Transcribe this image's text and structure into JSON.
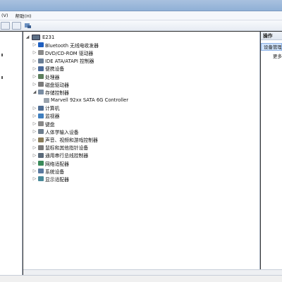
{
  "menubar": {
    "items": [
      {
        "label": "(V)"
      },
      {
        "label": "帮助(H)"
      }
    ]
  },
  "toolbar": {
    "buttons": [
      "back-icon",
      "properties-icon",
      "help-icon"
    ]
  },
  "tree": {
    "root": "E231",
    "nodes": [
      {
        "label": "Bluetooth 无线电收发器",
        "icon": "bluetooth-icon",
        "expanded": false
      },
      {
        "label": "DVD/CD-ROM 驱动器",
        "icon": "dvd-drive-icon",
        "expanded": false
      },
      {
        "label": "IDE ATA/ATAPI 控制器",
        "icon": "ide-controller-icon",
        "expanded": false
      },
      {
        "label": "便携设备",
        "icon": "portable-device-icon",
        "expanded": false
      },
      {
        "label": "处理器",
        "icon": "processor-icon",
        "expanded": false
      },
      {
        "label": "磁盘驱动器",
        "icon": "disk-drive-icon",
        "expanded": false
      },
      {
        "label": "存储控制器",
        "icon": "storage-controller-icon",
        "expanded": true
      },
      {
        "label": "Marvell 92xx SATA 6G Controller",
        "icon": "controller-device-icon",
        "child": true
      },
      {
        "label": "计算机",
        "icon": "computer-icon",
        "expanded": false
      },
      {
        "label": "监视器",
        "icon": "monitor-icon",
        "expanded": false
      },
      {
        "label": "键盘",
        "icon": "keyboard-icon",
        "expanded": false
      },
      {
        "label": "人体学输入设备",
        "icon": "hid-icon",
        "expanded": false
      },
      {
        "label": "声音、视频和游戏控制器",
        "icon": "sound-icon",
        "expanded": false
      },
      {
        "label": "鼠标和其他指针设备",
        "icon": "mouse-icon",
        "expanded": false
      },
      {
        "label": "通用串行总线控制器",
        "icon": "usb-icon",
        "expanded": false
      },
      {
        "label": "网络适配器",
        "icon": "network-adapter-icon",
        "expanded": false
      },
      {
        "label": "系统设备",
        "icon": "system-device-icon",
        "expanded": false
      },
      {
        "label": "显示适配器",
        "icon": "display-adapter-icon",
        "expanded": false
      }
    ]
  },
  "actions": {
    "header": "操作",
    "selected": "设备管理器",
    "more": "更多"
  },
  "colors": {
    "selection": "#cfe3fb",
    "title_bar": "#98b5d9"
  }
}
